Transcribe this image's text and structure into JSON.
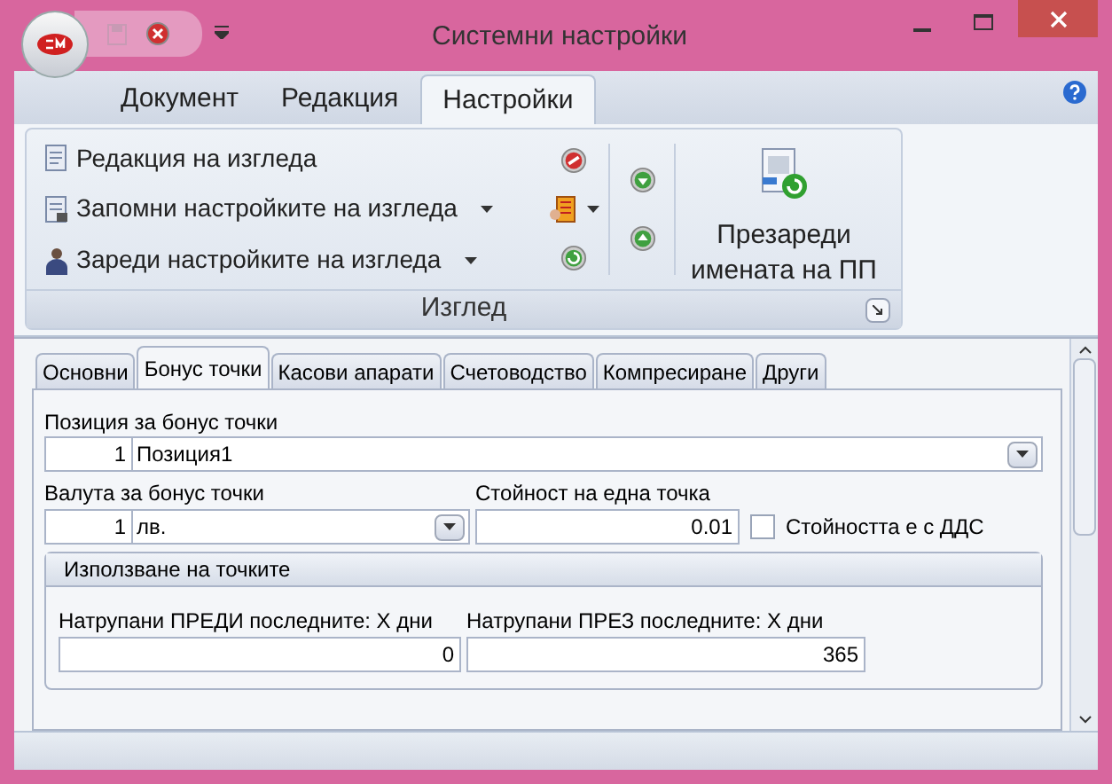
{
  "window": {
    "title": "Системни настройки"
  },
  "ribbon_tabs": [
    {
      "label": "Документ",
      "selected": false
    },
    {
      "label": "Редакция",
      "selected": false
    },
    {
      "label": "Настройки",
      "selected": true
    }
  ],
  "ribbon_group": {
    "label": "Изглед",
    "commands": [
      {
        "label": "Редакция на изгледа",
        "dropdown": false
      },
      {
        "label": "Запомни настройките на изгледа",
        "dropdown": true
      },
      {
        "label": "Зареди настройките на изгледа",
        "dropdown": true
      }
    ],
    "big_button": "Презареди имената на ПП"
  },
  "form_tabs": [
    {
      "label": "Основни",
      "selected": false
    },
    {
      "label": "Бонус точки",
      "selected": true
    },
    {
      "label": "Касови апарати",
      "selected": false
    },
    {
      "label": "Счетоводство",
      "selected": false
    },
    {
      "label": "Компресиране",
      "selected": false
    },
    {
      "label": "Други",
      "selected": false
    }
  ],
  "position": {
    "label": "Позиция за бонус точки",
    "code": "1",
    "value": "Позиция1"
  },
  "currency": {
    "label": "Валута за бонус точки",
    "code": "1",
    "value": "лв."
  },
  "point_value": {
    "label": "Стойност на една точка",
    "value": "0.01"
  },
  "vat_checkbox": {
    "label": "Стойността е с ДДС",
    "checked": false
  },
  "usage_group": {
    "title": "Използване на точките",
    "fields": [
      {
        "label": "Натрупани ПРЕДИ последните: Х дни",
        "value": "0"
      },
      {
        "label": "Натрупани ПРЕЗ последните: Х дни",
        "value": "365"
      }
    ]
  }
}
